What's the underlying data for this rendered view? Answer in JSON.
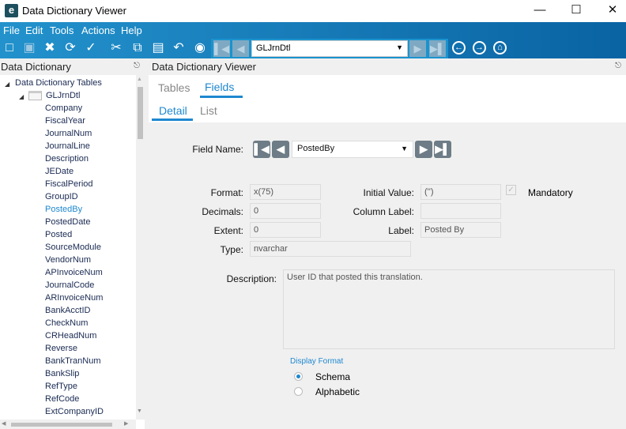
{
  "window": {
    "title": "Data Dictionary Viewer",
    "logo": "e"
  },
  "colors": {
    "accent": "#1e88d0",
    "toolbar_start": "#2392cc",
    "toolbar_end": "#0a63a3",
    "nav_button": "#6d7c86"
  },
  "menu": [
    "File",
    "Edit",
    "Tools",
    "Actions",
    "Help"
  ],
  "toolbar": {
    "table_combo": "GLJrnDtl",
    "icons": [
      "new-icon",
      "save-icon",
      "delete-icon",
      "refresh-icon",
      "clear-icon",
      "cut-icon",
      "copy-icon",
      "paste-icon",
      "undo-icon",
      "search-binoculars-icon",
      "first-icon",
      "previous-icon",
      "next-icon",
      "last-icon",
      "back-icon",
      "forward-icon",
      "home-icon"
    ]
  },
  "left_panel": {
    "title": "Data Dictionary",
    "root": "Data Dictionary Tables",
    "table": "GLJrnDtl",
    "fields": [
      "Company",
      "FiscalYear",
      "JournalNum",
      "JournalLine",
      "Description",
      "JEDate",
      "FiscalPeriod",
      "GroupID",
      "PostedBy",
      "PostedDate",
      "Posted",
      "SourceModule",
      "VendorNum",
      "APInvoiceNum",
      "JournalCode",
      "ARInvoiceNum",
      "BankAcctID",
      "CheckNum",
      "CRHeadNum",
      "Reverse",
      "BankTranNum",
      "BankSlip",
      "RefType",
      "RefCode",
      "ExtCompanyID"
    ],
    "selected": "PostedBy"
  },
  "right_panel": {
    "title": "Data Dictionary Viewer",
    "tabs": [
      {
        "label": "Tables"
      },
      {
        "label": "Fields",
        "active": true
      }
    ],
    "subtabs": [
      {
        "label": "Detail",
        "active": true
      },
      {
        "label": "List"
      }
    ],
    "form": {
      "field_name_label": "Field Name:",
      "field_name": "PostedBy",
      "format_label": "Format:",
      "format": "x(75)",
      "decimals_label": "Decimals:",
      "decimals": "0",
      "extent_label": "Extent:",
      "extent": "0",
      "type_label": "Type:",
      "type": "nvarchar",
      "initial_value_label": "Initial Value:",
      "initial_value": "('')",
      "column_label_label": "Column Label:",
      "column_label": "",
      "label_label": "Label:",
      "label": "Posted By",
      "mandatory_label": "Mandatory",
      "mandatory": true,
      "description_label": "Description:",
      "description": "User ID that posted this translation.",
      "display_format_title": "Display Format",
      "display_format_options": [
        "Schema",
        "Alphabetic"
      ],
      "display_format_selected": "Schema"
    }
  }
}
